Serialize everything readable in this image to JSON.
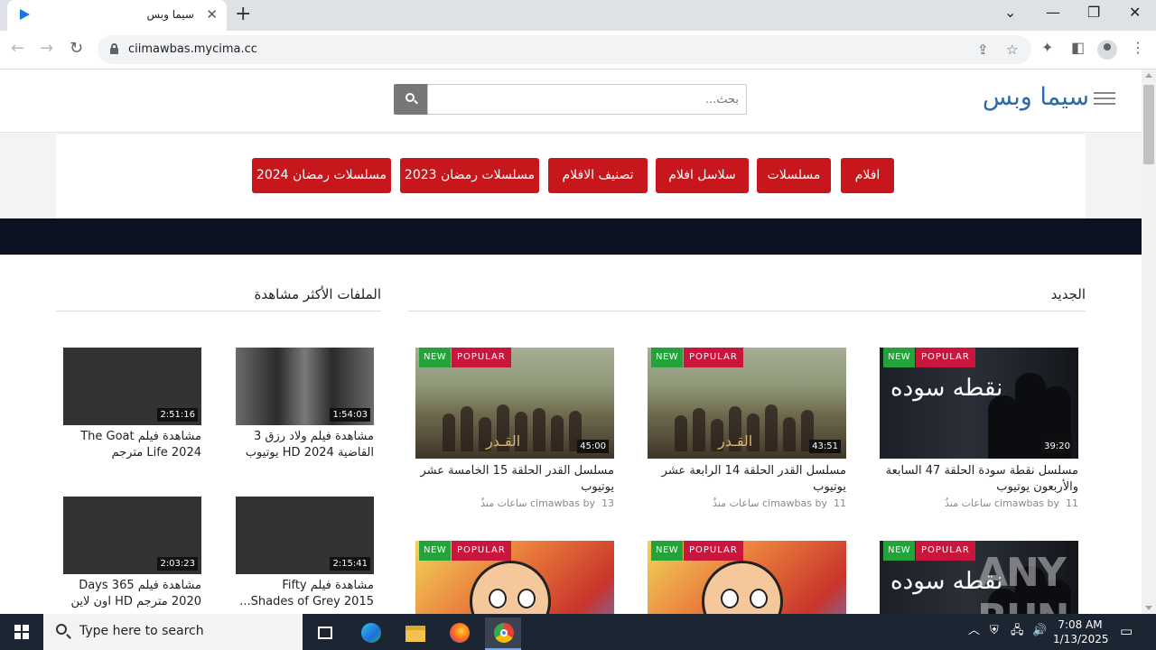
{
  "browser": {
    "tab_title": "سيما وبس",
    "url": "ciimawbas.mycima.cc"
  },
  "site": {
    "logo": "سيما وبس",
    "search_placeholder": "بحث...",
    "menu": [
      "افلام",
      "مسلسلات",
      "سلاسل افلام",
      "تصنيف الافلام",
      "مسلسلات رمضان 2023",
      "مسلسلات رمضان 2024"
    ]
  },
  "sections": {
    "latest_title": "الجديد",
    "most_viewed_title": "الملفات الأكثر مشاهدة"
  },
  "badges": {
    "new": "NEW",
    "popular": "POPULAR"
  },
  "latest": [
    {
      "title": "مسلسل نقطة سودة الحلقة 47 السابعة والأربعون يوتيوب",
      "duration": "39:20",
      "meta_count": "11",
      "meta_text": "ساعات منذُ",
      "author": "cimawbas",
      "thumb": "nokta"
    },
    {
      "title": "مسلسل القدر الحلقة 14 الرابعة عشر يوتيوب",
      "duration": "43:51",
      "meta_count": "11",
      "meta_text": "ساعات منذُ",
      "author": "cimawbas",
      "thumb": "qadr"
    },
    {
      "title": "مسلسل القدر الحلقة 15 الخامسة عشر يوتيوب",
      "duration": "45:00",
      "meta_count": "13",
      "meta_text": "ساعات منذُ",
      "author": "cimawbas",
      "thumb": "qadr"
    }
  ],
  "thumb_word_qadr": "القـدر",
  "thumb_word_nokta": "نقطه سوده",
  "most_viewed": [
    {
      "title": "مشاهدة فيلم ولاد رزق 3 القاضية 2024 HD يوتيوب",
      "duration": "1:54:03"
    },
    {
      "title": "مشاهدة فيلم The Goat Life 2024 مترجم",
      "duration": "2:51:16"
    },
    {
      "title": "مشاهدة فيلم Fifty Shades of Grey 2015...",
      "duration": "2:15:41"
    },
    {
      "title": "مشاهدة فيلم 365 Days 2020 مترجم HD اون لاين",
      "duration": "2:03:23"
    }
  ],
  "meta_by": "by",
  "watermark": "ANY RUN",
  "taskbar": {
    "search_text": "Type here to search",
    "time": "7:08 AM",
    "date": "1/13/2025"
  },
  "colors": {
    "menu_red": "#c8161d",
    "logo_blue": "#2d6aa8",
    "new_green": "#24a33a",
    "popular_red": "#c8163d",
    "dark_band": "#0b1322"
  }
}
